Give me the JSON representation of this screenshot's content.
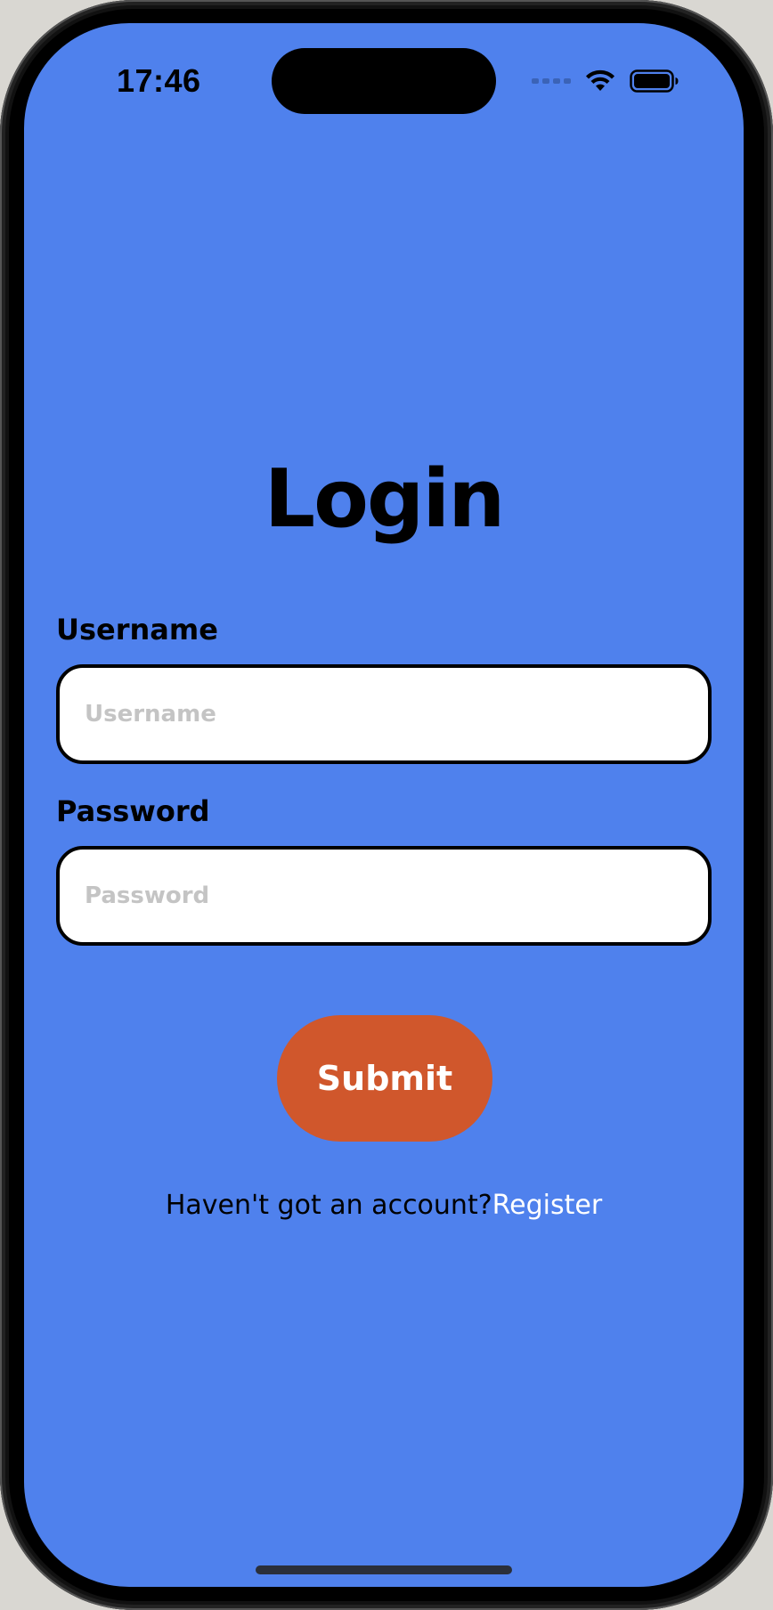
{
  "status_bar": {
    "time": "17:46",
    "icons": [
      "cellular-signal-icon",
      "wifi-icon",
      "battery-icon"
    ]
  },
  "login": {
    "title": "Login",
    "username": {
      "label": "Username",
      "value": "",
      "placeholder": "Username"
    },
    "password": {
      "label": "Password",
      "value": "",
      "placeholder": "Password"
    },
    "submit_label": "Submit",
    "register_prompt": "Haven't got an account?",
    "register_link": "Register"
  },
  "colors": {
    "background": "#4f81ed",
    "submit_button": "#d0572c",
    "input_background": "#ffffff",
    "register_link": "#ffffff"
  }
}
